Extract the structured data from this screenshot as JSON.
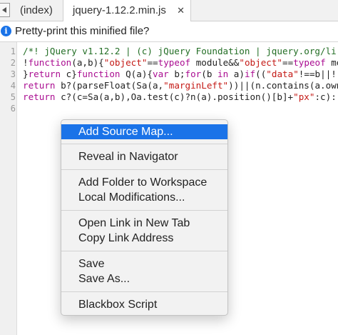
{
  "tabs": {
    "index_label": "(index)",
    "active_label": "jquery-1.12.2.min.js",
    "close_glyph": "✕"
  },
  "infobar": {
    "icon_glyph": "i",
    "message": "Pretty-print this minified file?"
  },
  "editor": {
    "line_numbers": [
      "1",
      "2",
      "3",
      "4",
      "5",
      "6"
    ]
  },
  "context_menu": {
    "add_source_map": "Add Source Map...",
    "reveal_in_navigator": "Reveal in Navigator",
    "add_folder_to_workspace": "Add Folder to Workspace",
    "local_modifications": "Local Modifications...",
    "open_link_in_new_tab": "Open Link in New Tab",
    "copy_link_address": "Copy Link Address",
    "save": "Save",
    "save_as": "Save As...",
    "blackbox_script": "Blackbox Script"
  },
  "colors": {
    "selection": "#1a73e8",
    "string": "#c41a16",
    "keyword": "#aa0d91",
    "comment": "#236e25"
  }
}
